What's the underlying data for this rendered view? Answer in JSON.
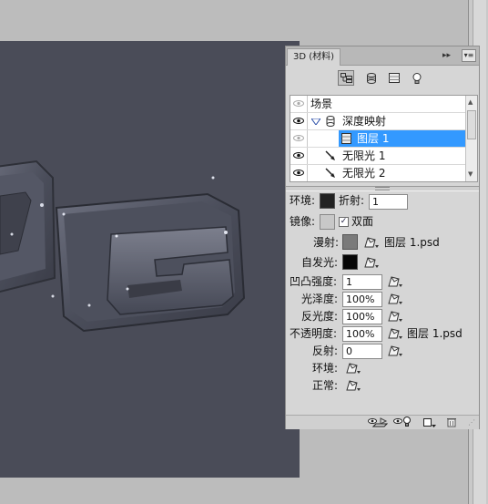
{
  "panel": {
    "tab_title": "3D (材料)",
    "collapse_label": "▸▸",
    "menu_label": "▾≡"
  },
  "toolbar": {
    "buttons": [
      {
        "name": "filter-whole-scene-icon",
        "active": true
      },
      {
        "name": "filter-meshes-icon",
        "active": false
      },
      {
        "name": "filter-materials-icon",
        "active": false
      },
      {
        "name": "filter-lights-icon",
        "active": false
      }
    ]
  },
  "scene_list": {
    "items": [
      {
        "label": "场景",
        "icon": "none",
        "visible": false,
        "selected": false
      },
      {
        "label": "深度映射",
        "icon": "mesh-icon",
        "visible": true,
        "selected": false
      },
      {
        "label": "图层 1",
        "icon": "material-icon",
        "visible": false,
        "selected": true
      },
      {
        "label": "无限光 1",
        "icon": "infinite-light-icon",
        "visible": true,
        "selected": false
      },
      {
        "label": "无限光 2",
        "icon": "infinite-light-icon",
        "visible": true,
        "selected": false
      }
    ]
  },
  "properties": {
    "ambient": {
      "label": "环境:",
      "color": "#222222"
    },
    "refraction": {
      "label": "折射:",
      "value": "1"
    },
    "reflection_color": {
      "label": "镜像:",
      "color": "#c8c8c8"
    },
    "two_sided": {
      "label": "双面",
      "checked": true
    },
    "diffuse": {
      "label": "漫射:",
      "color": "#7a7a7a",
      "texture": "图层 1.psd"
    },
    "self_illumination": {
      "label": "自发光:",
      "color": "#050505"
    },
    "bump_strength": {
      "label": "凹凸强度:",
      "value": "1"
    },
    "glossiness": {
      "label": "光泽度:",
      "value": "100%"
    },
    "shininess": {
      "label": "反光度:",
      "value": "100%"
    },
    "opacity": {
      "label": "不透明度:",
      "value": "100%",
      "texture": "图层 1.psd"
    },
    "reflectivity": {
      "label": "反射:",
      "value": "0"
    },
    "environment": {
      "label": "环境:"
    },
    "normal": {
      "label": "正常:"
    }
  },
  "bottom_bar": {
    "icons": [
      "toggle-ground-plane-icon",
      "toggle-lights-icon",
      "new-light-icon",
      "delete-icon"
    ]
  },
  "colors": {
    "canvas_bg": "#4a4c58",
    "selection": "#3399ff",
    "panel_bg": "#d6d6d6"
  }
}
